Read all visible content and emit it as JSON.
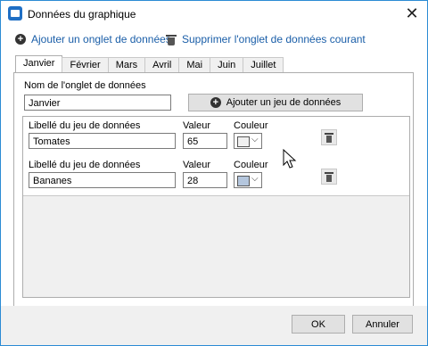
{
  "window": {
    "title": "Données du graphique",
    "close_glyph": "✕"
  },
  "toolbar": {
    "add_tab_label": "Ajouter un onglet de données",
    "delete_tab_label": "Supprimer l'onglet de données courant"
  },
  "tabs": [
    "Janvier",
    "Février",
    "Mars",
    "Avril",
    "Mai",
    "Juin",
    "Juillet"
  ],
  "active_tab": "Janvier",
  "tab_name": {
    "label": "Nom de l'onglet de données",
    "value": "Janvier"
  },
  "add_set_label": "Ajouter un jeu de données",
  "data_sets": [
    {
      "label_header": "Libellé du jeu de données",
      "label": "Tomates",
      "value_header": "Valeur",
      "value": "65",
      "color_header": "Couleur",
      "color": "#f0f0f0"
    },
    {
      "label_header": "Libellé du jeu de données",
      "label": "Bananes",
      "value_header": "Valeur",
      "value": "28",
      "color_header": "Couleur",
      "color": "#b4c6dd"
    }
  ],
  "footer": {
    "ok_label": "OK",
    "cancel_label": "Annuler"
  }
}
